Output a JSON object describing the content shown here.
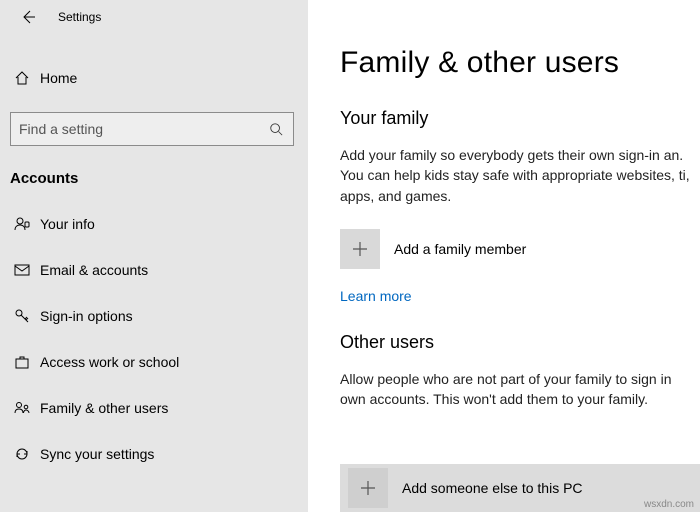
{
  "titlebar": {
    "title": "Settings"
  },
  "home": {
    "label": "Home"
  },
  "search": {
    "placeholder": "Find a setting"
  },
  "category": "Accounts",
  "nav": {
    "items": [
      {
        "label": "Your info"
      },
      {
        "label": "Email & accounts"
      },
      {
        "label": "Sign-in options"
      },
      {
        "label": "Access work or school"
      },
      {
        "label": "Family & other users"
      },
      {
        "label": "Sync your settings"
      }
    ]
  },
  "main": {
    "heading": "Family & other users",
    "family_head": "Your family",
    "family_para": "Add your family so everybody gets their own sign-in an. You can help kids stay safe with appropriate websites, ti, apps, and games.",
    "add_family": "Add a family member",
    "learn_more": "Learn more",
    "other_head": "Other users",
    "other_para": "Allow people who are not part of your family to sign in own accounts. This won't add them to your family.",
    "add_other": "Add someone else to this PC"
  },
  "watermark": "wsxdn.com"
}
